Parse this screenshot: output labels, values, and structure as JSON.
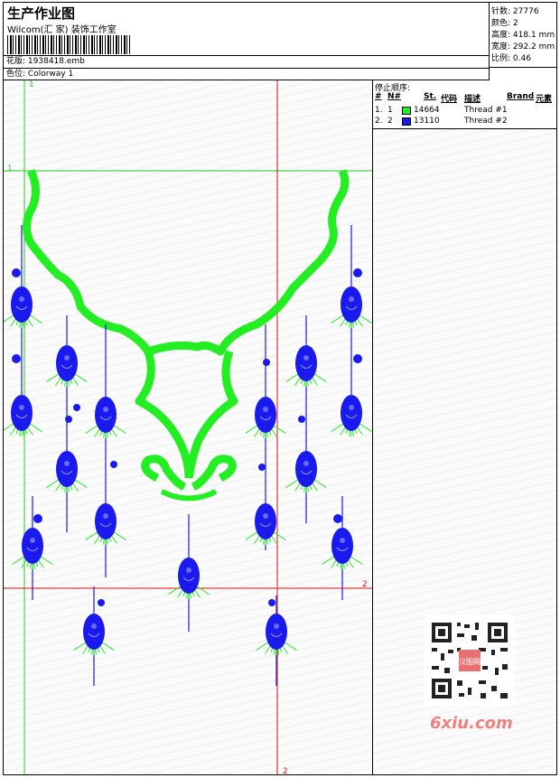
{
  "header": {
    "title": "生产作业图",
    "company": "Wilcom(汇 家) 装饰工作室",
    "design_label": "花版:",
    "design_value": "1938418.emb",
    "colorway_label": "色位:",
    "colorway_value": "Colorway 1"
  },
  "stats": [
    {
      "label": "针数:",
      "value": "27776"
    },
    {
      "label": "颜色:",
      "value": "2"
    },
    {
      "label": "高度:",
      "value": "418.1 mm"
    },
    {
      "label": "宽度:",
      "value": "292.2 mm"
    },
    {
      "label": "比例:",
      "value": "0.46"
    }
  ],
  "stop_sequence": {
    "title": "停止顺序:",
    "columns": [
      "#",
      "N#",
      "St.",
      "代码",
      "描述",
      "Brand",
      "元素"
    ],
    "rows": [
      {
        "num": "1.",
        "n": "1",
        "code": "14664",
        "desc": "Thread #1",
        "color": "#22ee22"
      },
      {
        "num": "2.",
        "n": "2",
        "code": "13110",
        "desc": "Thread #2",
        "color": "#1a1aee"
      }
    ]
  },
  "guides": {
    "v1_label": "1",
    "h1_label": "1",
    "v2_label": "2",
    "h2_label": "2"
  },
  "colors": {
    "green": "#22ee22",
    "blue": "#1a1aee",
    "guide_green": "#22cc22",
    "guide_red": "#dd1111"
  },
  "watermark": {
    "text": "6xiu.com",
    "qr_label": "汉图网"
  }
}
